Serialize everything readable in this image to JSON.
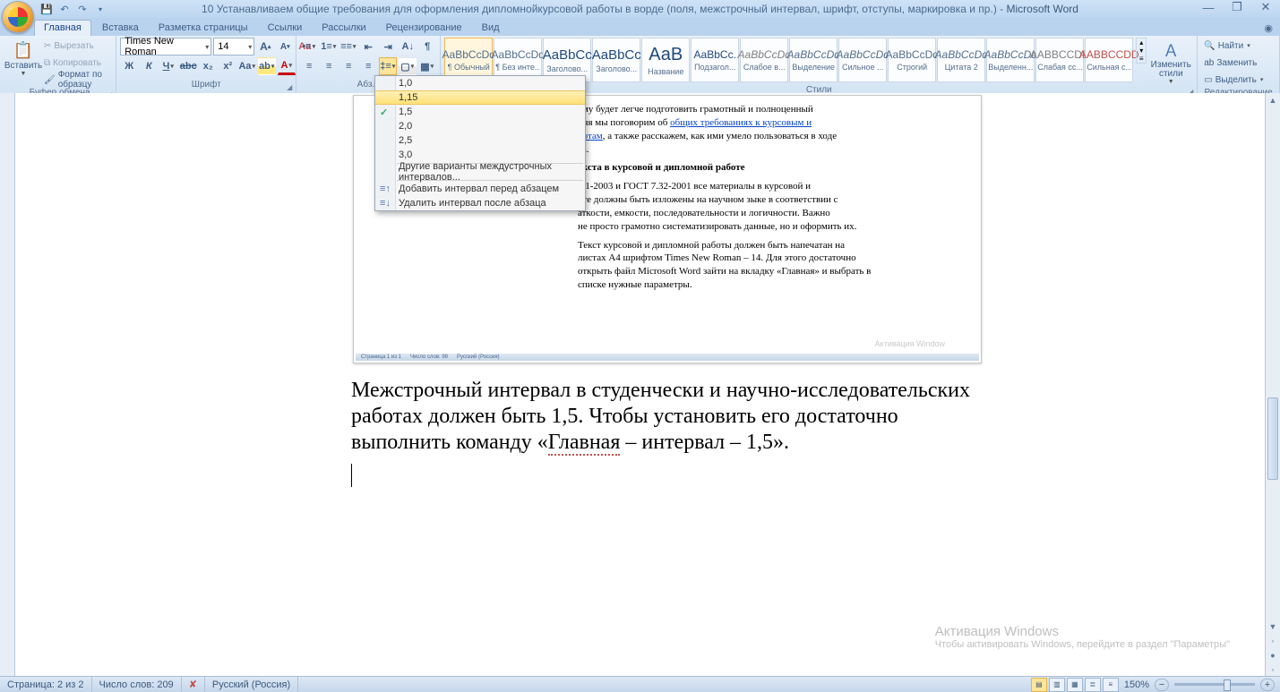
{
  "title": {
    "doc": "10 Устанавливаем общие требования для оформления дипломнойкурсовой работы в ворде (поля, межстрочный интервал, шрифт, отступы, маркировка и пр.)",
    "sep": " - ",
    "app": "Microsoft Word"
  },
  "tabs": [
    "Главная",
    "Вставка",
    "Разметка страницы",
    "Ссылки",
    "Рассылки",
    "Рецензирование",
    "Вид"
  ],
  "active_tab": 0,
  "clipboard": {
    "paste": "Вставить",
    "cut": "Вырезать",
    "copy": "Копировать",
    "format_painter": "Формат по образцу",
    "title": "Буфер обмена"
  },
  "font": {
    "name": "Times New Roman",
    "size": "14",
    "title": "Шрифт"
  },
  "paragraph": {
    "title": "Абз..."
  },
  "styles": {
    "title": "Стили",
    "change": "Изменить стили",
    "items": [
      {
        "sample": "AaBbCcDd",
        "label": "¶ Обычный",
        "cls": "",
        "sel": true
      },
      {
        "sample": "AaBbCcDd",
        "label": "¶ Без инте...",
        "cls": ""
      },
      {
        "sample": "AaBbCc",
        "label": "Заголово...",
        "cls": "st-blue",
        "big": true
      },
      {
        "sample": "AaBbCc",
        "label": "Заголово...",
        "cls": "st-blue",
        "big": true
      },
      {
        "sample": "АаВ",
        "label": "Название",
        "cls": "st-blue",
        "huge": true
      },
      {
        "sample": "AaBbCc.",
        "label": "Подзагол...",
        "cls": "st-blue"
      },
      {
        "sample": "AaBbCcDd",
        "label": "Слабое в...",
        "cls": "st-grey",
        "ital": true
      },
      {
        "sample": "AaBbCcDd",
        "label": "Выделение",
        "cls": "",
        "ital": true
      },
      {
        "sample": "AaBbCcDd",
        "label": "Сильное ...",
        "cls": "",
        "ital": true
      },
      {
        "sample": "AaBbCcDd",
        "label": "Строгий",
        "cls": ""
      },
      {
        "sample": "AaBbCcDd",
        "label": "Цитата 2",
        "cls": "",
        "ital": true
      },
      {
        "sample": "AaBbCcDd",
        "label": "Выделенн...",
        "cls": "",
        "ital": true
      },
      {
        "sample": "AABBCCDD",
        "label": "Слабая сс...",
        "cls": "st-grey"
      },
      {
        "sample": "AABBCCDD",
        "label": "Сильная с...",
        "cls": "st-red"
      }
    ]
  },
  "editing": {
    "find": "Найти",
    "replace": "Заменить",
    "select": "Выделить",
    "title": "Редактирование"
  },
  "line_spacing_menu": {
    "values": [
      "1,0",
      "1,15",
      "1,5",
      "2,0",
      "2,5",
      "3,0"
    ],
    "hover_index": 1,
    "checked_index": 2,
    "more": "Другие варианты междустрочных интервалов...",
    "add_before": "Добавить интервал перед абзацем",
    "remove_after": "Удалить интервал после абзаца"
  },
  "inner_doc": {
    "frag1": "ему будет  легче подготовить грамотный и полноценный",
    "frag2a": "дня мы поговорим об ",
    "frag2link": "общих требованиях к курсовым и",
    "frag3link": "ботам",
    "frag3": ", а также расскажем, как ими умело пользоваться в ходе",
    "frag4": "та.",
    "heading": "екста в курсовой  и дипломной работе",
    "p2a": "7.1-2003 и ГОСТ 7.32-2001 все материалы в курсовой и",
    "p2b": "оте должны быть изложены на научном зыке в соответствии с",
    "p2c": "аткости, емкости, последовательности и логичности. Важно",
    "p2d": "не просто грамотно систематизировать данные, но и оформить их.",
    "p3": "Текст курсовой и дипломной работы должен быть напечатан на листах А4 шрифтом Times New Roman – 14. Для этого достаточно открыть файл Microsoft Word зайти на вкладку «Главная» и выбрать в списке нужные параметры.",
    "wm1": "Активация Window",
    "wm2": ""
  },
  "body_paragraph": {
    "t1": "Межстрочный интервал в студенчески и научно-исследовательских работах должен быть 1,5. Чтобы установить его достаточно выполнить команду «",
    "und": "Главная",
    "t2": " – интервал – 1,5»."
  },
  "watermark": {
    "line1": "Активация Windows",
    "line2": "Чтобы активировать Windows, перейдите в раздел \"Параметры\""
  },
  "status": {
    "page": "Страница: 2 из 2",
    "words": "Число слов: 209",
    "lang": "Русский (Россия)",
    "zoom": "150%"
  }
}
